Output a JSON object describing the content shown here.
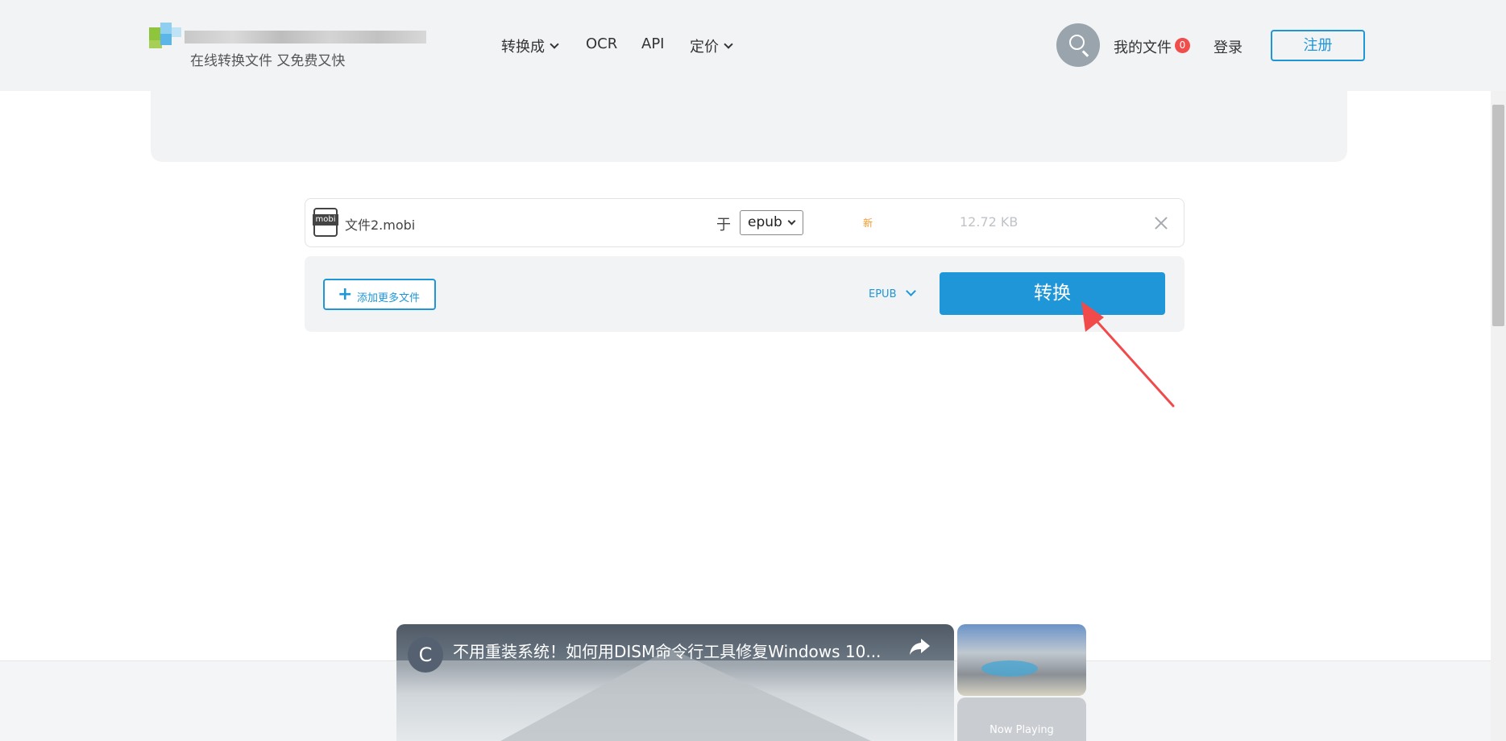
{
  "header": {
    "tagline": "在线转换文件 又免费又快",
    "nav": [
      {
        "label": "转换成",
        "has_dropdown": true
      },
      {
        "label": "OCR",
        "has_dropdown": false
      },
      {
        "label": "API",
        "has_dropdown": false
      },
      {
        "label": "定价",
        "has_dropdown": true
      }
    ],
    "search_icon": "search-icon",
    "my_files_label": "我的文件",
    "my_files_count": "0",
    "login_label": "登录",
    "register_label": "注册"
  },
  "file": {
    "icon_label": "mobi",
    "name": "文件2.mobi",
    "to_label": "于",
    "target_format": "epub",
    "status_label": "新",
    "size": "12.72 KB"
  },
  "actions": {
    "add_more_label": "添加更多文件",
    "batch_format_label": "EPUB",
    "convert_label": "转换"
  },
  "video": {
    "channel_initial": "C",
    "title": "不用重装系统！如何用DISM命令行工具修复Windows 10...",
    "now_playing_label": "Now Playing"
  },
  "colors": {
    "accent": "#1e96d8",
    "badge": "#f04d4d",
    "new_tag": "#f39a2b",
    "annotation_arrow": "#f04a4a"
  }
}
